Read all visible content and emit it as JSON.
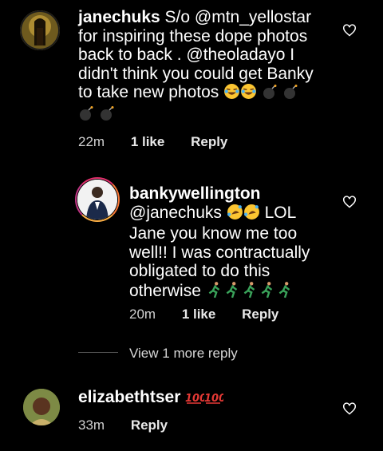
{
  "comments": [
    {
      "username": "janechuks",
      "text_line1": " S/o @mtn_yellostar",
      "text_line2": "for inspiring these dope photos",
      "text_line3": "back to back . @theoladayo I",
      "text_line4": "didn't think you could get Banky",
      "text_line5": "to take new photos",
      "time": "22m",
      "likes": "1 like",
      "reply": "Reply"
    },
    {
      "username": "bankywellington",
      "text_line1": "@janechuks",
      "text_line1b": " LOL",
      "text_line2": "Jane you know me too",
      "text_line3": "well!! I was contractually",
      "text_line4": "obligated to do this",
      "text_line5": "otherwise",
      "time": "20m",
      "likes": "1 like",
      "reply": "Reply"
    },
    {
      "username": "elizabethtser",
      "time": "33m",
      "reply": "Reply"
    }
  ],
  "view_more": "View 1 more reply",
  "icons": {
    "like": "heart-outline-icon",
    "laugh": "face-with-tears-of-joy-icon",
    "bomb": "bomb-icon",
    "rofl": "rolling-on-floor-laughing-icon",
    "runner": "person-running-icon",
    "hundred": "hundred-points-icon"
  },
  "colors": {
    "background": "#000000",
    "text": "#ffffff",
    "meta": "#d0d0d0"
  }
}
